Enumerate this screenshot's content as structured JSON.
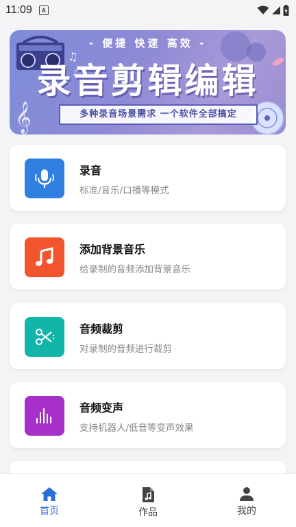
{
  "status_bar": {
    "time": "11:09",
    "notification_glyph": "A"
  },
  "banner": {
    "top_text": "- 便捷 快速 高效 -",
    "title": "录音剪辑编辑",
    "subtitle": "多种录音场景需求 一个软件全部搞定"
  },
  "features": [
    {
      "title": "录音",
      "desc": "标准/音乐/口播等模式",
      "icon": "microphone-icon",
      "color": "#2e7fe0"
    },
    {
      "title": "添加背景音乐",
      "desc": "给录制的音频添加背景音乐",
      "icon": "music-note-icon",
      "color": "#f2552d"
    },
    {
      "title": "音频裁剪",
      "desc": "对录制的音频进行裁剪",
      "icon": "scissors-icon",
      "color": "#12b5a8"
    },
    {
      "title": "音频变声",
      "desc": "支持机器人/低音等变声效果",
      "icon": "waveform-icon",
      "color": "#a630c8"
    }
  ],
  "bottom_nav": [
    {
      "label": "首页",
      "icon": "home-icon",
      "active": true
    },
    {
      "label": "作品",
      "icon": "music-file-icon",
      "active": false
    },
    {
      "label": "我的",
      "icon": "person-icon",
      "active": false
    }
  ],
  "colors": {
    "accent": "#2b6fd6",
    "background": "#f4f4f7"
  }
}
